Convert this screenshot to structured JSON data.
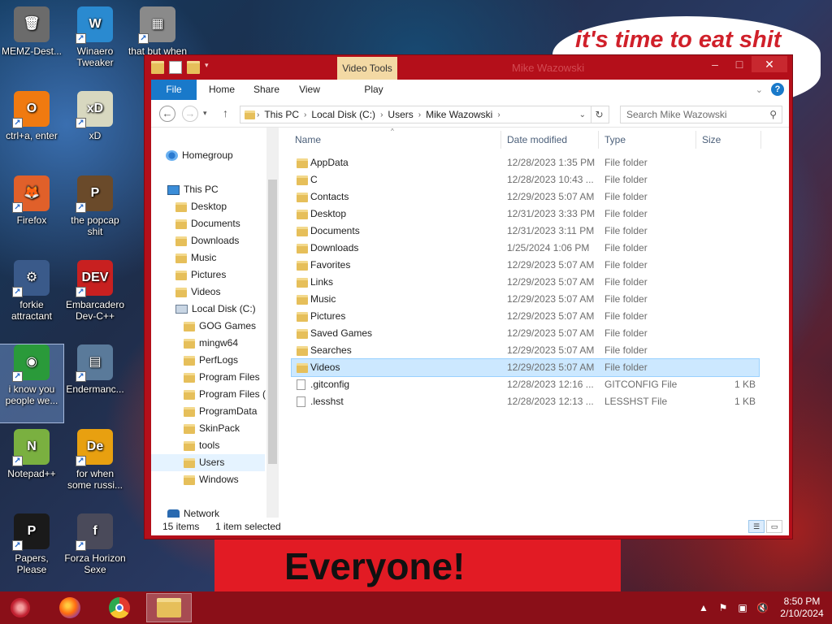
{
  "wallpaper": {
    "speech_text": "it's time to eat shit",
    "speech_tail": "te",
    "banner_text": "Everyone!"
  },
  "desktop_icons": [
    {
      "label": "MEMZ-Dest...",
      "color": "#6b6b6b",
      "glyph": "🗑"
    },
    {
      "label": "Winaero Tweaker",
      "color": "#2a8ad0",
      "glyph": "W"
    },
    {
      "label": "that but when",
      "color": "#8a8a8a",
      "glyph": "▦"
    },
    {
      "label": "ctrl+a, enter",
      "color": "#f07a10",
      "glyph": "O"
    },
    {
      "label": "xD",
      "color": "#d8d8c0",
      "glyph": "xD"
    },
    {
      "label": "Firefox",
      "color": "#e0602a",
      "glyph": "🦊"
    },
    {
      "label": "the popcap shit",
      "color": "#6a4a2a",
      "glyph": "P"
    },
    {
      "label": "forkie attractant",
      "color": "#3a5a8a",
      "glyph": "⚙"
    },
    {
      "label": "Embarcadero Dev-C++",
      "color": "#c82020",
      "glyph": "DEV"
    },
    {
      "label": "i know you people we...",
      "color": "#2a9a3a",
      "glyph": "◉"
    },
    {
      "label": "Endermanc...",
      "color": "#5a7a9a",
      "glyph": "▤"
    },
    {
      "label": "Notepad++",
      "color": "#7ab040",
      "glyph": "N"
    },
    {
      "label": "for when some russi...",
      "color": "#e8a010",
      "glyph": "De"
    },
    {
      "label": "Papers, Please",
      "color": "#1a1a1a",
      "glyph": "P"
    },
    {
      "label": "Forza Horizon Sexe",
      "color": "#4a4a5a",
      "glyph": "f"
    }
  ],
  "window": {
    "title": "Mike Wazowski",
    "context_tab": "Video Tools",
    "ribbon_tabs": [
      "File",
      "Home",
      "Share",
      "View",
      "Play"
    ],
    "address": [
      "This PC",
      "Local Disk (C:)",
      "Users",
      "Mike Wazowski"
    ],
    "search_placeholder": "Search Mike Wazowski",
    "nav": {
      "homegroup": "Homegroup",
      "thispc": "This PC",
      "pc_items": [
        "Desktop",
        "Documents",
        "Downloads",
        "Music",
        "Pictures",
        "Videos"
      ],
      "disk": "Local Disk (C:)",
      "disk_items": [
        "GOG Games",
        "mingw64",
        "PerfLogs",
        "Program Files",
        "Program Files (",
        "ProgramData",
        "SkinPack",
        "tools",
        "Users",
        "Windows"
      ],
      "network": "Network"
    },
    "columns": [
      "Name",
      "Date modified",
      "Type",
      "Size"
    ],
    "files": [
      {
        "name": "AppData",
        "date": "12/28/2023 1:35 PM",
        "type": "File folder",
        "size": "",
        "kind": "folder"
      },
      {
        "name": "C",
        "date": "12/28/2023 10:43 ...",
        "type": "File folder",
        "size": "",
        "kind": "folder"
      },
      {
        "name": "Contacts",
        "date": "12/29/2023 5:07 AM",
        "type": "File folder",
        "size": "",
        "kind": "folder"
      },
      {
        "name": "Desktop",
        "date": "12/31/2023 3:33 PM",
        "type": "File folder",
        "size": "",
        "kind": "folder"
      },
      {
        "name": "Documents",
        "date": "12/31/2023 3:11 PM",
        "type": "File folder",
        "size": "",
        "kind": "folder"
      },
      {
        "name": "Downloads",
        "date": "1/25/2024 1:06 PM",
        "type": "File folder",
        "size": "",
        "kind": "folder"
      },
      {
        "name": "Favorites",
        "date": "12/29/2023 5:07 AM",
        "type": "File folder",
        "size": "",
        "kind": "folder"
      },
      {
        "name": "Links",
        "date": "12/29/2023 5:07 AM",
        "type": "File folder",
        "size": "",
        "kind": "folder"
      },
      {
        "name": "Music",
        "date": "12/29/2023 5:07 AM",
        "type": "File folder",
        "size": "",
        "kind": "folder"
      },
      {
        "name": "Pictures",
        "date": "12/29/2023 5:07 AM",
        "type": "File folder",
        "size": "",
        "kind": "folder"
      },
      {
        "name": "Saved Games",
        "date": "12/29/2023 5:07 AM",
        "type": "File folder",
        "size": "",
        "kind": "folder"
      },
      {
        "name": "Searches",
        "date": "12/29/2023 5:07 AM",
        "type": "File folder",
        "size": "",
        "kind": "folder"
      },
      {
        "name": "Videos",
        "date": "12/29/2023 5:07 AM",
        "type": "File folder",
        "size": "",
        "kind": "folder"
      },
      {
        "name": ".gitconfig",
        "date": "12/28/2023 12:16 ...",
        "type": "GITCONFIG File",
        "size": "1 KB",
        "kind": "file"
      },
      {
        "name": ".lesshst",
        "date": "12/28/2023 12:13 ...",
        "type": "LESSHST File",
        "size": "1 KB",
        "kind": "file"
      }
    ],
    "selected_file": "Videos",
    "status": {
      "count": "15 items",
      "selection": "1 item selected"
    }
  },
  "taskbar": {
    "clock_time": "8:50 PM",
    "clock_date": "2/10/2024"
  },
  "colors": {
    "accent": "#1979ca",
    "window_frame": "#b40f1a",
    "taskbar": "#8a0f18",
    "selection": "#cce8ff"
  }
}
